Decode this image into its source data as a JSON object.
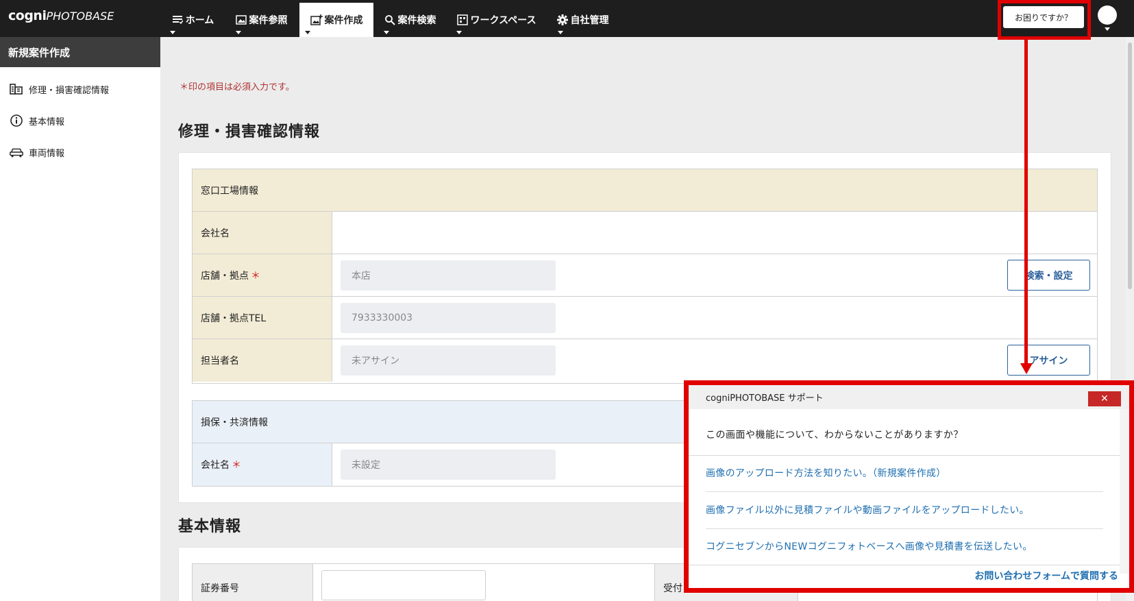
{
  "app": {
    "logo_main": "cogni",
    "logo_sub": "PHOTOBASE"
  },
  "nav": {
    "items": [
      {
        "label": "ホーム",
        "icon": "list-icon"
      },
      {
        "label": "案件参照",
        "icon": "image-icon"
      },
      {
        "label": "案件作成",
        "icon": "image-add-icon"
      },
      {
        "label": "案件検索",
        "icon": "search-icon"
      },
      {
        "label": "ワークスペース",
        "icon": "workspace-icon"
      },
      {
        "label": "自社管理",
        "icon": "gear-icon"
      }
    ],
    "active_index": 2,
    "help_label": "お困りですか？"
  },
  "sidebar": {
    "title": "新規案件作成",
    "items": [
      {
        "label": "修理・損害確認情報",
        "icon": "building-icon"
      },
      {
        "label": "基本情報",
        "icon": "info-icon"
      },
      {
        "label": "車両情報",
        "icon": "car-icon"
      }
    ]
  },
  "main": {
    "required_note": "＊印の項目は必須入力です。",
    "section1_title": "修理・損害確認情報",
    "window_shop": {
      "header": "窓口工場情報",
      "rows": [
        {
          "label": "会社名",
          "value": ""
        },
        {
          "label": "店舗・拠点",
          "required_mark": "＊",
          "value": "本店",
          "button": "検索・設定"
        },
        {
          "label": "店舗・拠点TEL",
          "value": "7933330003"
        },
        {
          "label": "担当者名",
          "value": "未アサイン",
          "button": "アサイン"
        }
      ]
    },
    "insurance": {
      "header": "損保・共済情報",
      "rows": [
        {
          "label": "会社名",
          "required_mark": "＊",
          "value": "未設定"
        }
      ]
    },
    "section2_title": "基本情報",
    "basic": {
      "policy_label": "証券番号",
      "receipt_label": "受付"
    }
  },
  "support": {
    "title": "cogniPHOTOBASE サポート",
    "close_label": "✕",
    "question": "この画面や機能について、わからないことがありますか？",
    "links": [
      "画像のアップロード方法を知りたい。（新規案件作成）",
      "画像ファイル以外に見積ファイルや動画ファイルをアップロードしたい。",
      "コグニセブンからNEWコグニフォトベースへ画像や見積書を伝送したい。"
    ],
    "footer_link": "お問い合わせフォームで質問する"
  },
  "colors": {
    "topbar": "#1e1e1e",
    "highlight": "#e00000",
    "beige": "#f2ecd6",
    "light_blue": "#eaf0f7",
    "link": "#1f6fb0",
    "button_blue": "#2a5f9a"
  }
}
